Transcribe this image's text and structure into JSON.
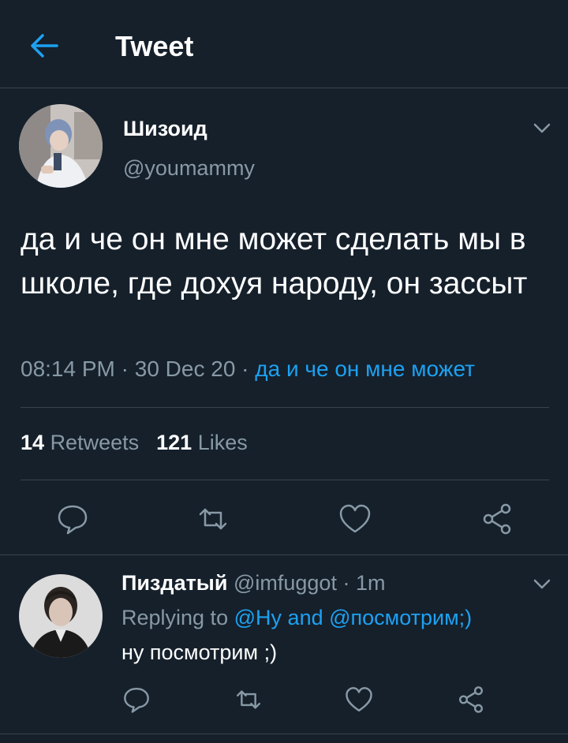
{
  "header": {
    "title": "Tweet"
  },
  "tweet": {
    "author_name": "Шизоид",
    "author_handle": "@youmammy",
    "text": "да и че он мне может сделать мы в школе, где дохуя народу, он зассыт",
    "time": "08:14 PM",
    "date": "30 Dec 20",
    "source_link": "да и че он мне может",
    "retweets_count": "14",
    "retweets_label": "Retweets",
    "likes_count": "121",
    "likes_label": "Likes"
  },
  "reply": {
    "author_name": "Пиздатый",
    "author_handle": "@imfuggot",
    "age": "1m",
    "replying_prefix": "Replying to",
    "mention_1": "@Hy",
    "and_word": "and",
    "mention_2": "@посмотрим;)",
    "text": "ну посмотрим ;)"
  },
  "colors": {
    "background": "#15202b",
    "accent": "#1da1f2",
    "secondary_text": "#8899a6",
    "divider": "#38444d"
  },
  "icons": [
    "back-arrow-icon",
    "chevron-down-icon",
    "reply-icon",
    "retweet-icon",
    "like-icon",
    "share-icon"
  ]
}
